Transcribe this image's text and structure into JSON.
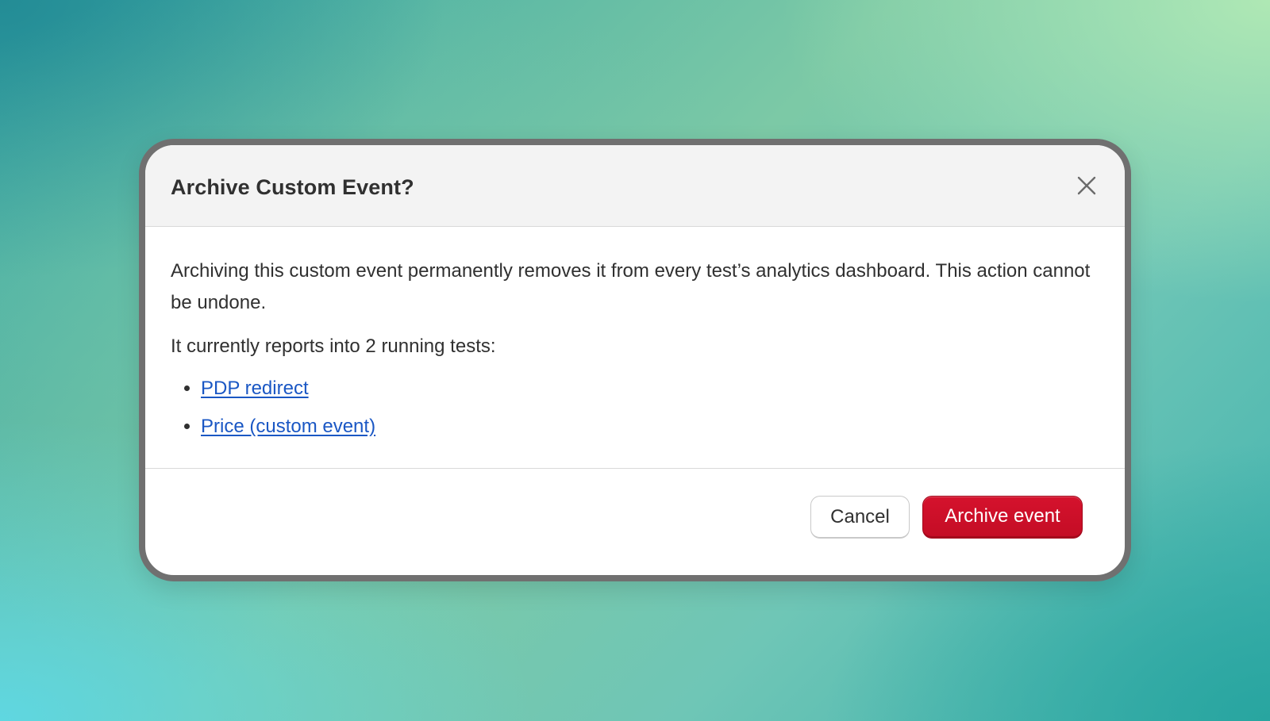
{
  "dialog": {
    "title": "Archive Custom Event?",
    "close_icon": "close-icon",
    "description": "Archiving this custom event permanently removes it from every test’s analytics dashboard. This action cannot be undone.",
    "reports_text": "It currently reports into 2 running tests:",
    "tests": [
      {
        "label": "PDP redirect"
      },
      {
        "label": "Price (custom event)"
      }
    ],
    "cancel_label": "Cancel",
    "archive_label": "Archive event",
    "colors": {
      "danger": "#c8102e",
      "link": "#1a57c4",
      "header_bg": "#f3f3f3"
    }
  }
}
